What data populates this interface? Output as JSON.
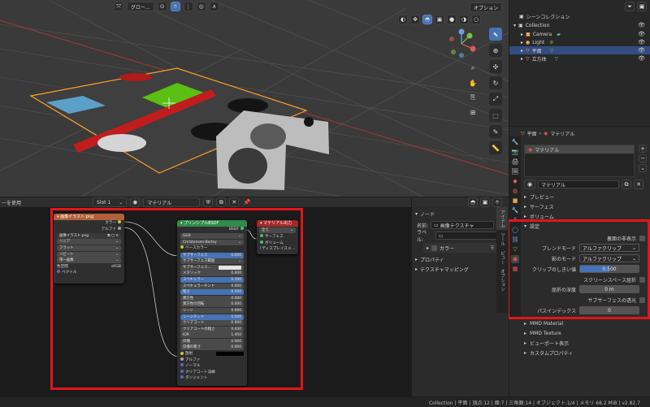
{
  "viewport": {
    "transform_label": "グロー...",
    "options_label": "オプション"
  },
  "outliner": {
    "scene_collection": "シーンコレクション",
    "items": [
      {
        "label": "Collection"
      },
      {
        "label": "Camera"
      },
      {
        "label": "Light"
      },
      {
        "label": "平面"
      },
      {
        "label": "立方体"
      }
    ]
  },
  "node_header": {
    "left_label": "ーを使用",
    "slot": "Slot 1",
    "material": "マテリアル"
  },
  "nodes": {
    "image": {
      "title": "画像イラスト.png",
      "out_color": "カラー",
      "out_alpha": "アルファ",
      "file": "画像イラスト.png",
      "interp": "リニア",
      "proj": "フラット",
      "ext": "リピート",
      "source": "単一画像",
      "colorspace_label": "色空間",
      "colorspace_value": "sRGB",
      "vector": "ベクトル"
    },
    "bsdf": {
      "title": "プリンシプルBSDF",
      "out": "BSDF",
      "dist": "GGX",
      "sss": "Christensen-Burley",
      "fields": [
        {
          "label": "ベースカラー",
          "value": ""
        },
        {
          "label": "サブサーフェス",
          "value": "0.000"
        },
        {
          "label": "サブサーフェス範囲",
          "value": ""
        },
        {
          "label": "サブサーフェス...",
          "value": ""
        },
        {
          "label": "メタリック",
          "value": "0.000"
        },
        {
          "label": "スペキュラー",
          "value": "0.500"
        },
        {
          "label": "スペキュラーチント",
          "value": "0.000"
        },
        {
          "label": "粗さ",
          "value": "0.500"
        },
        {
          "label": "異方性",
          "value": "0.000"
        },
        {
          "label": "異方性の回転",
          "value": "0.000"
        },
        {
          "label": "シーン",
          "value": "0.000"
        },
        {
          "label": "シーンチント",
          "value": "0.500"
        },
        {
          "label": "クリアコート",
          "value": "0.000"
        },
        {
          "label": "クリアコートの粗さ",
          "value": "0.030"
        },
        {
          "label": "IOR",
          "value": "1.450"
        },
        {
          "label": "伝播",
          "value": "0.000"
        },
        {
          "label": "伝播の粗さ",
          "value": "0.000"
        }
      ],
      "emission": "放射",
      "inputs": [
        "アルファ",
        "ノーマル",
        "クリアコート法線",
        "タンジェント"
      ]
    },
    "output": {
      "title": "マテリアル出力",
      "target": "全て",
      "inputs": [
        "サーフェス",
        "ボリューム",
        "ディスプレイスメ..."
      ]
    }
  },
  "node_panel": {
    "title": "ノード",
    "name_label": "名前:",
    "name_value": "画像テクスチャ",
    "label_label": "ラベル:",
    "color_label": "カラー",
    "sections": [
      "プロパティ",
      "テクスチャマッピング"
    ],
    "tabs": [
      "アイテム",
      "ツール",
      "ビュー",
      "オプション"
    ]
  },
  "properties": {
    "object_name": "平面",
    "material_label": "マテリアル",
    "slot_name": "マテリアル",
    "material_name": "マテリアル",
    "sections": [
      "プレビュー",
      "サーフェス",
      "ボリューム"
    ],
    "settings": {
      "title": "設定",
      "backface": "裏面の非表示",
      "blend_label": "ブレンドモード",
      "blend_value": "アルファクリップ",
      "shadow_label": "影のモード",
      "shadow_value": "アルファクリップ",
      "clip_label": "クリップのしきい値",
      "clip_value": "0.500",
      "ssr": "スクリーンスペース屈折",
      "depth_label": "屈折の深度",
      "depth_value": "0 m",
      "sss_trans": "サブサーフェスの透光",
      "pass_label": "パスインデックス",
      "pass_value": "0"
    },
    "more_sections": [
      "MMD Material",
      "MMD Texture",
      "ビューポート表示",
      "カスタムプロパティ"
    ]
  },
  "status_bar": "Collection | 平面 | 頂点:12 | 面:7 | 三角面:14 | オブジェクト:1/4 | メモリ 68.2 MiB | v2.82.7",
  "colors": {
    "accent": "#4772b3",
    "highlight_box": "#e4141b",
    "selection": "#ff9e2b"
  }
}
